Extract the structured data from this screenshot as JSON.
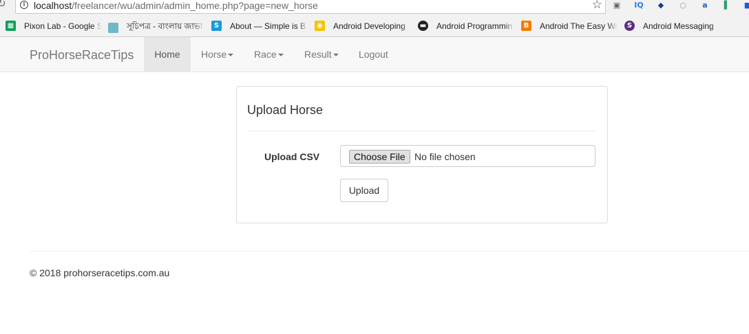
{
  "browser": {
    "url_host": "localhost",
    "url_path": "/freelancer/wu/admin/admin_home.php?page=new_horse",
    "bookmarks": [
      {
        "label": "Pixon Lab - Google S",
        "icon": "sheets-icon",
        "color": "#0f9d58"
      },
      {
        "label": "সূচিপত্র - বাংলায় জাভা",
        "icon": "bangla-site-icon",
        "color": "#6fb7c9"
      },
      {
        "label": "About — Simple is B",
        "icon": "s-blue-icon",
        "color": "#1a9bd7"
      },
      {
        "label": "Android Developing",
        "icon": "android-dev-icon",
        "color": "#f5c400"
      },
      {
        "label": "Android Programmin",
        "icon": "android-prog-icon",
        "color": "#222222"
      },
      {
        "label": "Android The Easy Wa",
        "icon": "blogger-icon",
        "color": "#f57d00"
      },
      {
        "label": "Android Messaging",
        "icon": "s-purple-icon",
        "color": "#5a2d82"
      }
    ]
  },
  "navbar": {
    "brand": "ProHorseRaceTips",
    "items": [
      {
        "label": "Home"
      },
      {
        "label": "Horse"
      },
      {
        "label": "Race"
      },
      {
        "label": "Result"
      },
      {
        "label": "Logout"
      }
    ]
  },
  "panel": {
    "title": "Upload Horse",
    "field_label": "Upload CSV",
    "choose_file_label": "Choose File",
    "no_file_text": "No file chosen",
    "upload_button": "Upload"
  },
  "footer": {
    "text": "© 2018 prohorseracetips.com.au"
  }
}
